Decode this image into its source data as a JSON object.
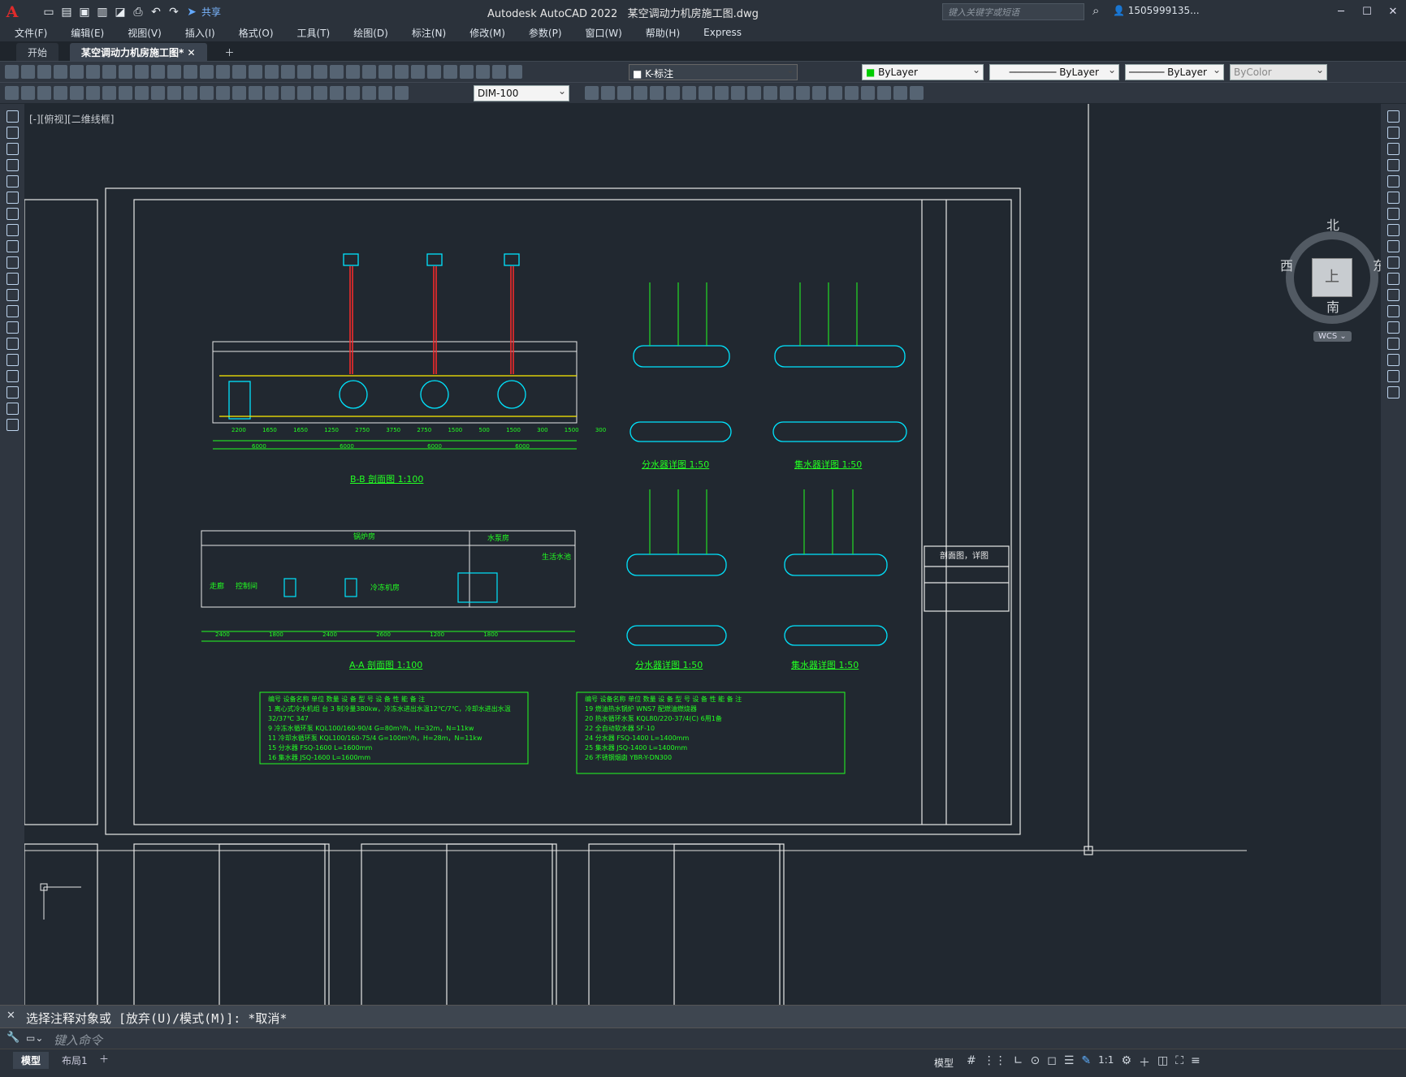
{
  "app": {
    "title": "Autodesk AutoCAD 2022",
    "file": "某空调动力机房施工图.dwg",
    "logo": "A",
    "share": "共享",
    "search_placeholder": "键入关键字或短语",
    "user": "1505999135..."
  },
  "menu": [
    "文件(F)",
    "编辑(E)",
    "视图(V)",
    "插入(I)",
    "格式(O)",
    "工具(T)",
    "绘图(D)",
    "标注(N)",
    "修改(M)",
    "参数(P)",
    "窗口(W)",
    "帮助(H)",
    "Express"
  ],
  "tabs": [
    {
      "label": "开始"
    },
    {
      "label": "某空调动力机房施工图*"
    }
  ],
  "toolbar": {
    "layer": "K-标注",
    "color": "ByLayer",
    "linetype": "ByLayer",
    "lineweight": "ByLayer",
    "plotstyle": "ByColor",
    "dimstyle": "DIM-100"
  },
  "view_label": "[-][俯视][二维线框]",
  "viewcube": {
    "north": "北",
    "south": "南",
    "east": "东",
    "west": "西",
    "top": "上",
    "wcs": "WCS"
  },
  "drawing": {
    "bb_title": "B-B 剖面图 1:100",
    "aa_title": "A-A 剖面图 1:100",
    "fen1": "分水器详图 1:50",
    "ji1": "集水器详图 1:50",
    "fen2": "分水器详图 1:50",
    "ji2": "集水器详图 1:50",
    "boiler_room": "锅炉房",
    "pump_room": "水泵房",
    "water_pool": "生活水池",
    "chiller_room": "冷冻机房",
    "corridor": "走廊",
    "control_room": "控制间",
    "sheet_title": "剖面图，详图",
    "dims_bb": [
      "2200",
      "1650",
      "1650",
      "1250",
      "2750",
      "3750",
      "2750",
      "1500",
      "500",
      "1500",
      "300",
      "1500",
      "300"
    ],
    "axes_bb": [
      "6000",
      "6000",
      "6000",
      "6000"
    ],
    "dims_aa": [
      "2400",
      "1800",
      "2400",
      "2600",
      "1200",
      "1800"
    ],
    "schedule_left": {
      "headers": [
        "编号",
        "设备名称",
        "单位",
        "数量",
        "设 备 型 号",
        "设 备 性 能",
        "备 注"
      ],
      "rows": [
        [
          "1",
          "离心式冷水机组",
          "台",
          "3",
          "",
          "制冷量380kw，冷冻水进出水温12℃/7℃，冷却水进出水温32/37℃",
          "347"
        ],
        [
          "9",
          "冷冻水循环泵",
          "台",
          "3",
          "KQL100/160-90/4",
          "G=80m³/h，H=32m，N=11kw",
          "70"
        ],
        [
          "11",
          "冷却水循环泵",
          "台",
          "3",
          "KQL100/160-75/4",
          "G=100m³/h，H=28m，N=11kw",
          "70"
        ],
        [
          "15",
          "分水器",
          "个",
          "1",
          "FSQ-1600",
          "L=1600mm",
          ""
        ],
        [
          "16",
          "集水器",
          "个",
          "1",
          "JSQ-1600",
          "L=1600mm",
          ""
        ]
      ]
    },
    "schedule_right": {
      "headers": [
        "编号",
        "设备名称",
        "单位",
        "数量",
        "设 备 型 号",
        "设 备 性 能",
        "备 注"
      ],
      "rows": [
        [
          "19",
          "燃油热水锅炉",
          "台",
          "3",
          "WNS7",
          "额定热功率700kw，供回水温95℃/70℃，燃油耗量60kg/h",
          "20",
          "配燃油燃烧器"
        ],
        [
          "20",
          "热水循环水泵",
          "台",
          "3",
          "KQL80/220-37/4(C)",
          "G=24m³/h，H=30m，N=4kw",
          "97",
          "6用1备"
        ],
        [
          "22",
          "全自动软水器",
          "台",
          "1",
          "SF-10",
          "Q=10m³/h，LB800×2×1800",
          ""
        ],
        [
          "24",
          "分水器",
          "个",
          "1",
          "FSQ-1400",
          "L=1400mm",
          ""
        ],
        [
          "25",
          "集水器",
          "个",
          "1",
          "JSQ-1400",
          "L=1400mm",
          ""
        ],
        [
          "26",
          "不锈钢烟囱",
          "个",
          "3",
          "YBR-Y-DN300",
          "",
          ""
        ]
      ]
    }
  },
  "command": {
    "history": "选择注释对象或 [放弃(U)/模式(M)]: *取消*",
    "placeholder": "键入命令"
  },
  "layout_tabs": [
    {
      "label": "模型"
    },
    {
      "label": "布局1"
    }
  ],
  "status": {
    "model": "模型",
    "scale": "1:1"
  }
}
